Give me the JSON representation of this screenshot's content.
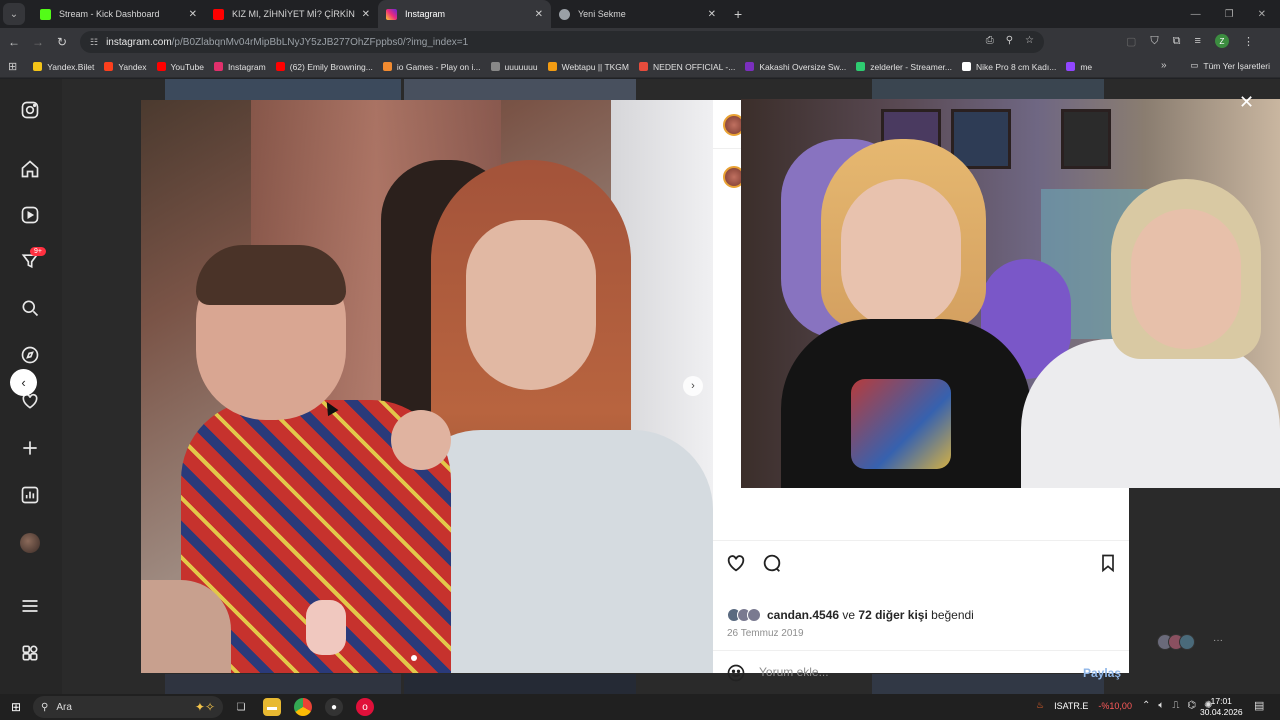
{
  "browser": {
    "tabs": [
      {
        "title": "Stream - Kick Dashboard",
        "color": "#53fc18"
      },
      {
        "title": "KIZ MI, ZİHNİYET Mİ? ÇİRKİN D",
        "color": "#ff0000"
      },
      {
        "title": "Instagram",
        "color": "#e1306c"
      },
      {
        "title": "Yeni Sekme",
        "color": "#9aa0a6"
      }
    ],
    "active_tab_index": 2,
    "url_main": "instagram.com",
    "url_path": "/p/B0ZlabqnMv04rMipBbLNyJY5zJB277OhZFppbs0/?img_index=1",
    "profile_initial": "Z"
  },
  "bookmarks": {
    "items": [
      {
        "label": "Yandex.Bilet",
        "color": "#f5c518"
      },
      {
        "label": "Yandex",
        "color": "#fc3f1d"
      },
      {
        "label": "YouTube",
        "color": "#ff0000"
      },
      {
        "label": "Instagram",
        "color": "#e1306c"
      },
      {
        "label": "(62) Emily Browning...",
        "color": "#ff0000"
      },
      {
        "label": "io Games - Play on i...",
        "color": "#f28b30"
      },
      {
        "label": "uuuuuuu",
        "color": "#888888"
      },
      {
        "label": "Webtapu || TKGM",
        "color": "#f39c12"
      },
      {
        "label": "NEDEN OFFICIAL -...",
        "color": "#e74c3c"
      },
      {
        "label": "Kakashi Oversize Sw...",
        "color": "#7b2fbe"
      },
      {
        "label": "zelderler - Streamer...",
        "color": "#2ecc71"
      },
      {
        "label": "Nike Pro 8 cm Kadı...",
        "color": "#ffffff"
      },
      {
        "label": "me",
        "color": "#9146ff"
      }
    ],
    "all_bookmarks": "Tüm Yer İşaretleri"
  },
  "sidebar": {
    "notification_badge": "9+"
  },
  "post": {
    "liked_by_user": "candan.4546",
    "likes_connector": "ve",
    "others_count": "72 diğer kişi",
    "liked_suffix": "beğendi",
    "date": "26 Temmuz 2019",
    "comment_placeholder": "Yorum ekle...",
    "post_button": "Paylaş"
  },
  "taskbar": {
    "search_placeholder": "Ara",
    "ticker_symbol": "ISATR.E",
    "ticker_change": "-%10,00",
    "time": "17:01",
    "date": "30.04.2026"
  }
}
